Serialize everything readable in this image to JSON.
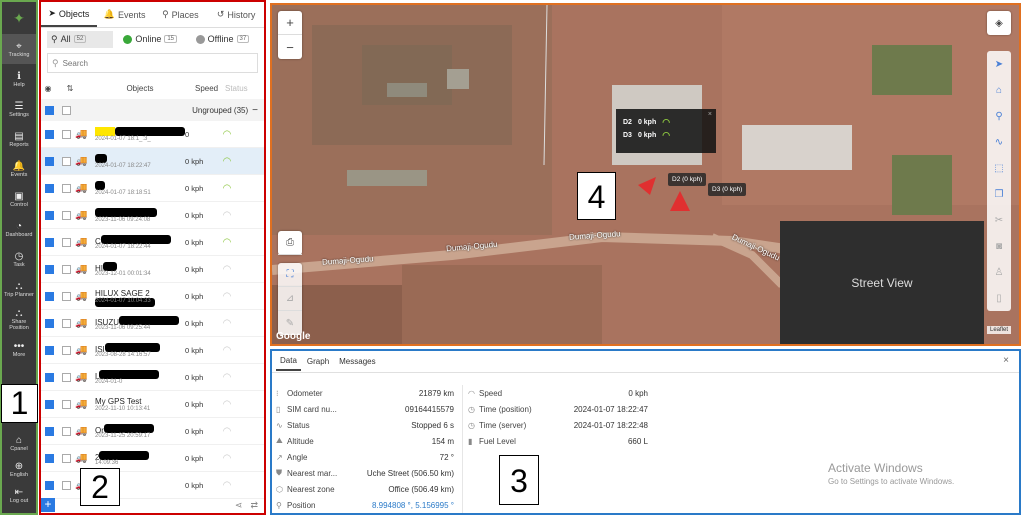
{
  "nav": {
    "items": [
      {
        "label": "Tracking",
        "icon": "crosshair-icon",
        "glyph": "⌖",
        "active": true
      },
      {
        "label": "Help",
        "icon": "help-icon",
        "glyph": "ℹ"
      },
      {
        "label": "Settings",
        "icon": "sliders-icon",
        "glyph": "☰"
      },
      {
        "label": "Reports",
        "icon": "report-icon",
        "glyph": "▤"
      },
      {
        "label": "Events",
        "icon": "bell-icon",
        "glyph": "🔔"
      },
      {
        "label": "Control",
        "icon": "control-icon",
        "glyph": "▣"
      },
      {
        "label": "Dashboard",
        "icon": "dashboard-icon",
        "glyph": "◔"
      },
      {
        "label": "Task",
        "icon": "task-icon",
        "glyph": "◷"
      },
      {
        "label": "Trip Planner",
        "icon": "trip-planner-icon",
        "glyph": "⛬"
      },
      {
        "label": "Share Position",
        "icon": "share-position-icon",
        "glyph": "⛬"
      },
      {
        "label": "More",
        "icon": "more-icon",
        "glyph": "•••"
      }
    ],
    "bottom": [
      {
        "label": "Cpanel",
        "icon": "cpanel-icon",
        "glyph": "⌂"
      },
      {
        "label": "English",
        "icon": "globe-icon",
        "glyph": "⊕"
      },
      {
        "label": "Log out",
        "icon": "logout-icon",
        "glyph": "⇤"
      }
    ]
  },
  "callouts": {
    "c1": "1",
    "c2": "2",
    "c3": "3",
    "c4": "4"
  },
  "panel": {
    "tabs": [
      {
        "label": "Objects",
        "glyph": "➤",
        "icon": "navigation-icon",
        "active": true
      },
      {
        "label": "Events",
        "glyph": "🔔",
        "icon": "bell-icon"
      },
      {
        "label": "Places",
        "glyph": "⚲",
        "icon": "map-pin-icon"
      },
      {
        "label": "History",
        "glyph": "↺",
        "icon": "history-icon"
      }
    ],
    "filters": {
      "all": {
        "label": "All",
        "count": "52"
      },
      "online": {
        "label": "Online",
        "count": "15",
        "color": "#3aa83a"
      },
      "offline": {
        "label": "Offline",
        "count": "37",
        "color": "#999999"
      }
    },
    "search_placeholder": "Search",
    "columns": {
      "objects": "Objects",
      "speed": "Speed",
      "status": "Status"
    },
    "group_label": "Ungrouped (35)",
    "group_toggle": "−",
    "rows": [
      {
        "name": "",
        "time": "2024-01-07 18:1_:3_",
        "speed": "0",
        "online": true,
        "redact": 70,
        "highlight": true
      },
      {
        "name": "",
        "time": "2024-01-07 18:22:47",
        "speed": "0 kph",
        "online": true,
        "redact": 12,
        "selected": true
      },
      {
        "name": "",
        "time": "2024-01-07 18:18:51",
        "speed": "0 kph",
        "online": true,
        "redact": 10
      },
      {
        "name": "",
        "time": "2023-11-06 09:24:08",
        "speed": "0 kph",
        "online": false,
        "redact": 62
      },
      {
        "name": "C",
        "time": "2024-01-07 18:22:44",
        "speed": "0 kph",
        "online": true,
        "redact": 70
      },
      {
        "name": "HI",
        "time": "2023-12-01 00:01:34",
        "speed": "0 kph",
        "online": false,
        "redact": 14
      },
      {
        "name": "HILUX SAGE 2",
        "time": "2024-01-07 10:04:33",
        "speed": "0 kph",
        "online": false,
        "redact": 60
      },
      {
        "name": "ISUZU",
        "time": "2023-11-06 09:25:44",
        "speed": "0 kph",
        "online": false,
        "redact": 60
      },
      {
        "name": "ISI",
        "time": "2023-08-28 14:16:57",
        "speed": "0 kph",
        "online": false,
        "redact": 55
      },
      {
        "name": "L",
        "time": "2024-01-0",
        "speed": "0 kph",
        "online": false,
        "redact": 60
      },
      {
        "name": "My GPS Test",
        "time": "2022-11-10 10:13:41",
        "speed": "0 kph",
        "online": false,
        "redact": 0
      },
      {
        "name": "Or",
        "time": "2023-11-25 20:59:17",
        "speed": "0 kph",
        "online": false,
        "redact": 50
      },
      {
        "name": "2",
        "time": "14:09:36",
        "speed": "0 kph",
        "online": false,
        "redact": 50
      },
      {
        "name": "C-1",
        "time": "",
        "speed": "0 kph",
        "online": false,
        "redact": 0
      }
    ]
  },
  "map": {
    "zoom_in": "+",
    "zoom_out": "−",
    "popup": [
      {
        "name": "D2",
        "speed": "0 kph"
      },
      {
        "name": "D3",
        "speed": "0 kph"
      }
    ],
    "popup_close": "×",
    "tag_d2": "D2 (0 kph)",
    "tag_d3": "D3 (0 kph)",
    "roads": [
      "Dumaji-Ogudu",
      "Dumaji-Ogudu",
      "Dumaji-Ogudu",
      "Dumaji-Ogudu"
    ],
    "street_view": "Street View",
    "google": "Google",
    "leaflet": "Leaflet"
  },
  "data": {
    "tabs": [
      "Data",
      "Graph",
      "Messages"
    ],
    "close": "×",
    "left": [
      {
        "label": "Odometer",
        "value": "21879 km",
        "icon": "odometer-icon",
        "glyph": "⁝"
      },
      {
        "label": "SIM card nu...",
        "value": "09164415579",
        "icon": "sim-card-icon",
        "glyph": "▯"
      },
      {
        "label": "Status",
        "value": "Stopped 6 s",
        "icon": "status-icon",
        "glyph": "∿"
      },
      {
        "label": "Altitude",
        "value": "154 m",
        "icon": "altitude-icon",
        "glyph": "⛰"
      },
      {
        "label": "Angle",
        "value": "72 °",
        "icon": "angle-icon",
        "glyph": "↗"
      },
      {
        "label": "Nearest mar...",
        "value": "Uche Street (506.50 km)",
        "icon": "marker-icon",
        "glyph": "⛊"
      },
      {
        "label": "Nearest zone",
        "value": "Office (506.49 km)",
        "icon": "zone-icon",
        "glyph": "⬡"
      },
      {
        "label": "Position",
        "value": "8.994808 °, 5.156995 °",
        "icon": "map-pin-icon",
        "glyph": "⚲",
        "link": true
      }
    ],
    "right": [
      {
        "label": "Speed",
        "value": "0 kph",
        "icon": "speedometer-icon",
        "glyph": "◠"
      },
      {
        "label": "Time (position)",
        "value": "2024-01-07 18:22:47",
        "icon": "clock-icon",
        "glyph": "◷"
      },
      {
        "label": "Time (server)",
        "value": "2024-01-07 18:22:48",
        "icon": "clock-icon",
        "glyph": "◷"
      },
      {
        "label": "Fuel Level",
        "value": "660 L",
        "icon": "fuel-icon",
        "glyph": "▮"
      }
    ],
    "activate_title": "Activate Windows",
    "activate_sub": "Go to Settings to activate Windows."
  }
}
